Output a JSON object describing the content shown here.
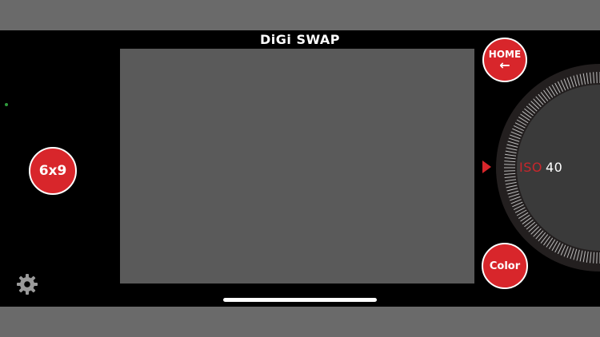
{
  "app": {
    "title": "DiGi SWAP"
  },
  "buttons": {
    "format_label": "6x9",
    "home_label": "HOME",
    "home_arrow": "←",
    "color_label": "Color"
  },
  "dial": {
    "label": "ISO",
    "value": "40"
  },
  "icons": {
    "settings": "gear-icon",
    "pointer": "triangle-right-icon",
    "status": "status-dot-icon"
  },
  "colors": {
    "accent": "#d8262b",
    "background": "#000000",
    "viewfinder": "#5a5a5a",
    "status_dot": "#2f9a3c"
  }
}
